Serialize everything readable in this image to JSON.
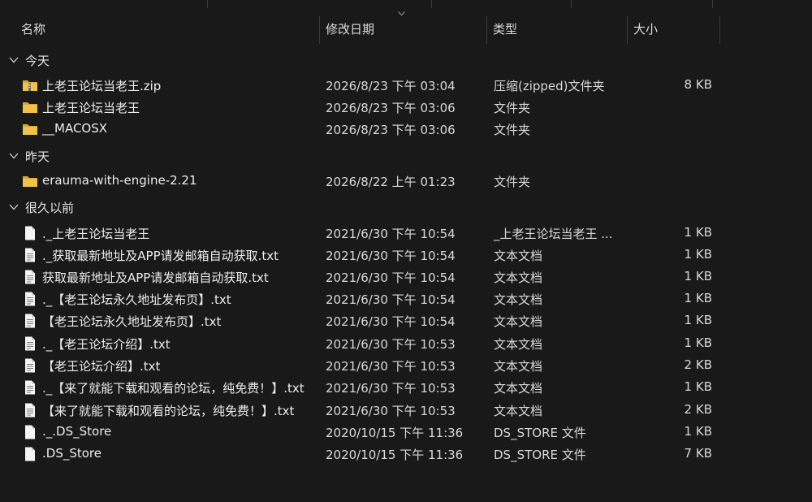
{
  "columns": {
    "name": "名称",
    "date": "修改日期",
    "type": "类型",
    "size": "大小"
  },
  "colors": {
    "background": "#191919",
    "folder": "#f1c24a",
    "folder_dark": "#d9a62c",
    "text": "#ededed"
  },
  "groups": [
    {
      "label": "今天",
      "rows": [
        {
          "name": "上老王论坛当老王.zip",
          "date": "2026/8/23 下午 03:04",
          "type": "压缩(zipped)文件夹",
          "size": "8 KB",
          "icon": "zip-folder-icon"
        },
        {
          "name": "上老王论坛当老王",
          "date": "2026/8/23 下午 03:06",
          "type": "文件夹",
          "size": "",
          "icon": "folder-icon"
        },
        {
          "name": "__MACOSX",
          "date": "2026/8/23 下午 03:06",
          "type": "文件夹",
          "size": "",
          "icon": "folder-icon"
        }
      ]
    },
    {
      "label": "昨天",
      "rows": [
        {
          "name": "erauma-with-engine-2.21",
          "date": "2026/8/22 上午 01:23",
          "type": "文件夹",
          "size": "",
          "icon": "folder-icon"
        }
      ]
    },
    {
      "label": "很久以前",
      "rows": [
        {
          "name": "._上老王论坛当老王",
          "date": "2021/6/30 下午 10:54",
          "type": "_上老王论坛当老王 ...",
          "size": "1 KB",
          "icon": "file-icon"
        },
        {
          "name": "._获取最新地址及APP请发邮箱自动获取.txt",
          "date": "2021/6/30 下午 10:54",
          "type": "文本文档",
          "size": "1 KB",
          "icon": "text-file-icon"
        },
        {
          "name": "获取最新地址及APP请发邮箱自动获取.txt",
          "date": "2021/6/30 下午 10:54",
          "type": "文本文档",
          "size": "1 KB",
          "icon": "text-file-icon"
        },
        {
          "name": "._【老王论坛永久地址发布页】.txt",
          "date": "2021/6/30 下午 10:54",
          "type": "文本文档",
          "size": "1 KB",
          "icon": "text-file-icon"
        },
        {
          "name": "【老王论坛永久地址发布页】.txt",
          "date": "2021/6/30 下午 10:54",
          "type": "文本文档",
          "size": "1 KB",
          "icon": "text-file-icon"
        },
        {
          "name": "._【老王论坛介绍】.txt",
          "date": "2021/6/30 下午 10:53",
          "type": "文本文档",
          "size": "1 KB",
          "icon": "text-file-icon"
        },
        {
          "name": "【老王论坛介绍】.txt",
          "date": "2021/6/30 下午 10:53",
          "type": "文本文档",
          "size": "2 KB",
          "icon": "text-file-icon"
        },
        {
          "name": "._【来了就能下载和观看的论坛，纯免费！】.txt",
          "date": "2021/6/30 下午 10:53",
          "type": "文本文档",
          "size": "1 KB",
          "icon": "text-file-icon"
        },
        {
          "name": "【来了就能下载和观看的论坛，纯免费！】.txt",
          "date": "2021/6/30 下午 10:53",
          "type": "文本文档",
          "size": "2 KB",
          "icon": "text-file-icon"
        },
        {
          "name": "._.DS_Store",
          "date": "2020/10/15 下午 11:36",
          "type": "DS_STORE 文件",
          "size": "1 KB",
          "icon": "file-icon"
        },
        {
          "name": ".DS_Store",
          "date": "2020/10/15 下午 11:36",
          "type": "DS_STORE 文件",
          "size": "7 KB",
          "icon": "file-icon"
        }
      ]
    }
  ]
}
